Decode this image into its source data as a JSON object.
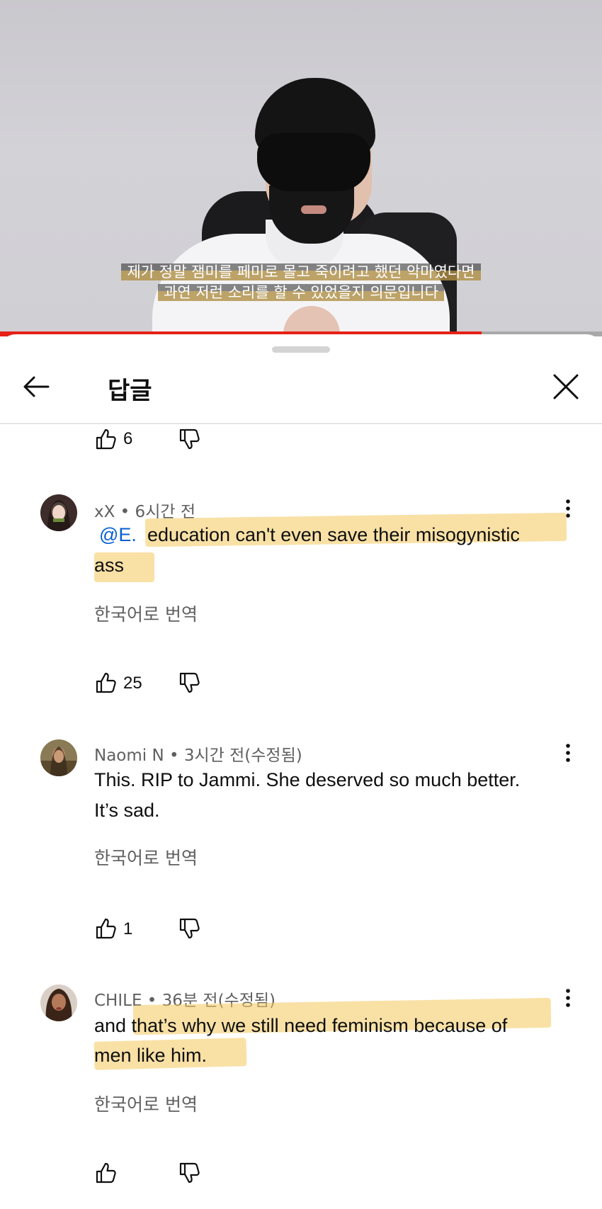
{
  "video": {
    "subtitle_line1": "제가 정말 잼미를 페미로 몰고 죽이려고 했던 악마였다면",
    "subtitle_line2": "과연 저런 소리를 할 수 있었을지 의문입니다",
    "progress": 0.8,
    "progress_color": "#e62117"
  },
  "header": {
    "title": "답글",
    "back_icon": "arrow-left-icon",
    "close_icon": "close-icon"
  },
  "top_actions": {
    "like_count": "6"
  },
  "comments": [
    {
      "author_meta": "xX • 6시간 전",
      "mention": "@E.",
      "text_line1": "education can't even save their misogynistic",
      "text_line2": "ass",
      "translate": "한국어로 번역",
      "like_count": "25"
    },
    {
      "author_meta": "Naomi N • 3시간 전(수정됨)",
      "text_line1": "This. RIP to Jammi. She deserved so much better.",
      "text_line2": "It’s sad.",
      "translate": "한국어로 번역",
      "like_count": "1"
    },
    {
      "author_meta": "CHILE • 36분 전(수정됨)",
      "text_line1": "and that’s why we still need feminism because of",
      "text_line2": "men like him.",
      "translate": "한국어로 번역",
      "like_count": ""
    }
  ],
  "colors": {
    "highlight": "#f4c95c",
    "mention": "#065fd4",
    "meta_text": "#606060"
  }
}
